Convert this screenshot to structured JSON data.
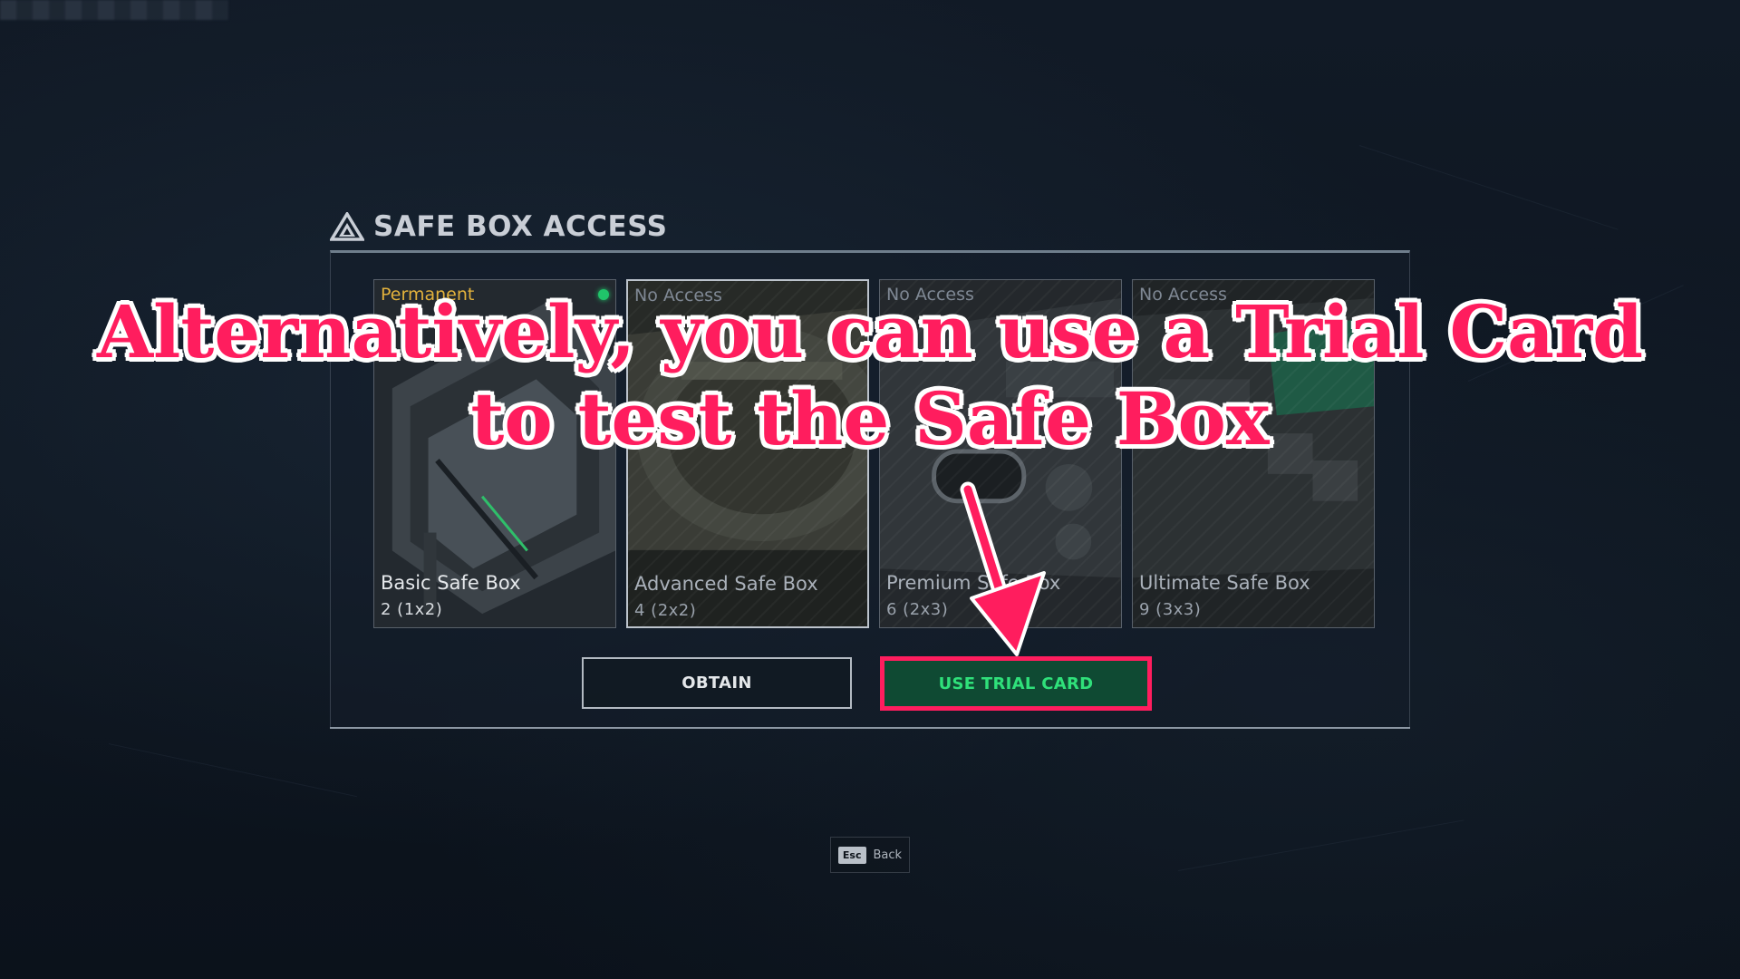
{
  "header": {
    "title": "SAFE BOX ACCESS",
    "icon": "triangle-logo-icon"
  },
  "cards": [
    {
      "status": "Permanent",
      "name": "Basic Safe Box",
      "size": "2 (1x2)",
      "owned": true
    },
    {
      "status": "No Access",
      "name": "Advanced Safe Box",
      "size": "4 (2x2)",
      "owned": false
    },
    {
      "status": "No Access",
      "name": "Premium Safe Box",
      "size": "6 (2x3)",
      "owned": false
    },
    {
      "status": "No Access",
      "name": "Ultimate Safe Box",
      "size": "9 (3x3)",
      "owned": false
    }
  ],
  "buttons": {
    "obtain": "OBTAIN",
    "use_trial_card": "USE TRIAL CARD"
  },
  "footer": {
    "key": "Esc",
    "label": "Back"
  },
  "overlay": {
    "line1": "Alternatively, you can use a Trial Card",
    "line2": "to test the Safe Box"
  },
  "colors": {
    "highlight": "#ff1d5e",
    "trial_button_text": "#2fe07a",
    "permanent_status": "#e3b23c"
  }
}
